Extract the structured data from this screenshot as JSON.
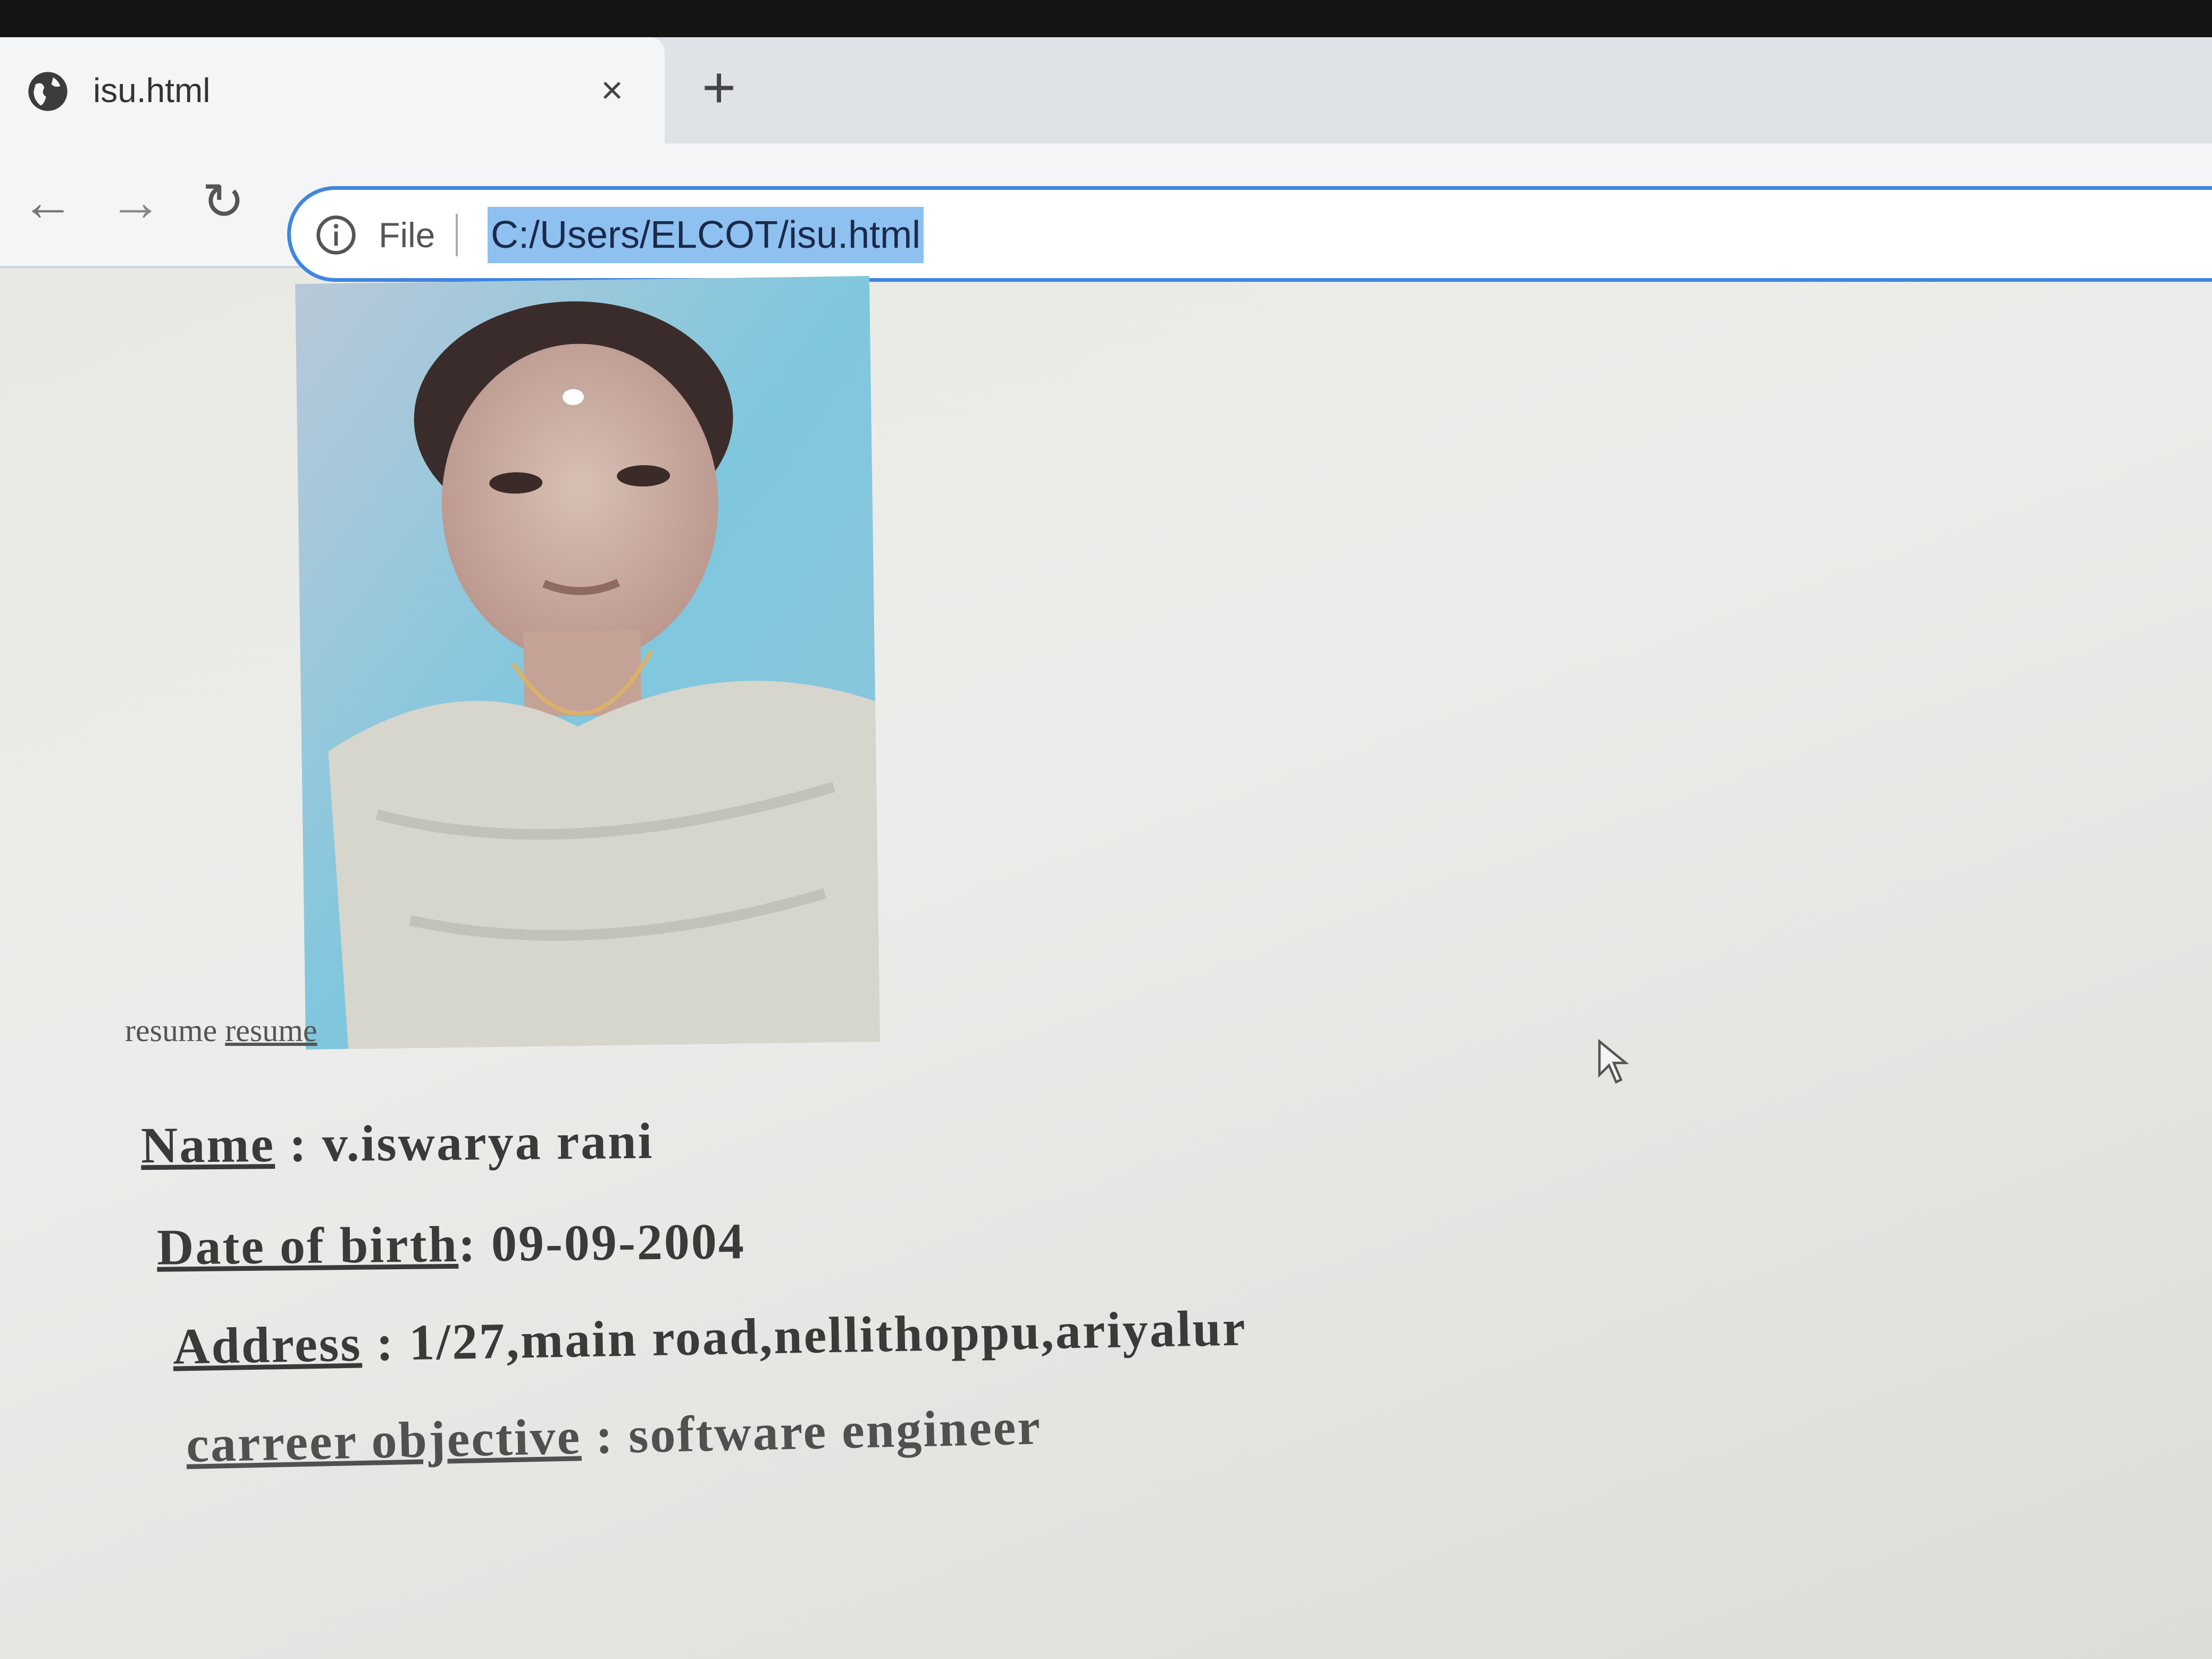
{
  "browser": {
    "tab": {
      "title": "isu.html",
      "favicon": "globe-icon",
      "close_label": "×"
    },
    "new_tab_label": "+",
    "nav": {
      "back_label": "←",
      "forward_label": "→",
      "reload_label": "↻"
    },
    "omnibox": {
      "info_icon": "info-icon",
      "scheme_label": "File",
      "url": "C:/Users/ELCOT/isu.html"
    }
  },
  "page": {
    "photo_alt": "resume",
    "resume_text": "resume",
    "resume_link": "resume",
    "fields": [
      {
        "label": "Name",
        "sep": " : ",
        "value": "v.iswarya rani"
      },
      {
        "label": "Date of birth",
        "sep": ": ",
        "value": "09-09-2004"
      },
      {
        "label": "Address",
        "sep": " : ",
        "value": "1/27,main road,nellithoppu,ariyalur"
      },
      {
        "label": "carreer objective",
        "sep": " : ",
        "value": "software engineer"
      }
    ]
  },
  "colors": {
    "accent": "#3f86e0",
    "url_selection": "#8ec0f0",
    "page_background": "#ececea"
  }
}
